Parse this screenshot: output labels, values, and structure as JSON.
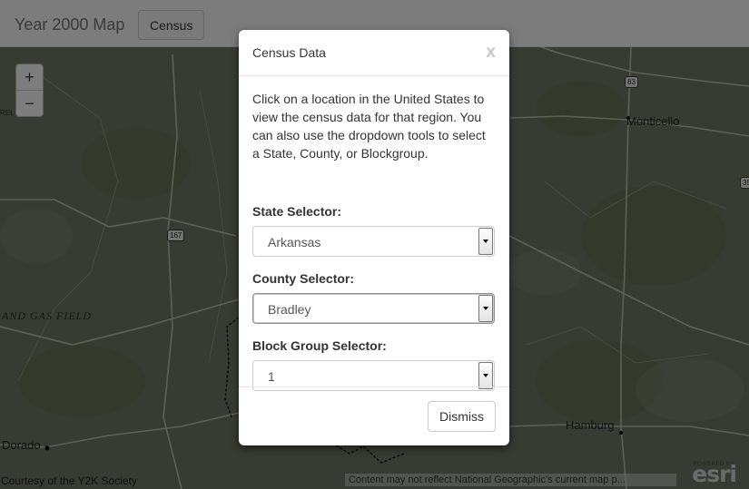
{
  "header": {
    "brand": "Year 2000 Map",
    "census_button": "Census"
  },
  "zoom": {
    "in": "+",
    "out": "−"
  },
  "map": {
    "places": [
      "Monticello",
      "Hamburg",
      "Dorado"
    ],
    "field_label": "AND GAS FIELD",
    "edge_label": "REL",
    "shields": [
      "83",
      "167",
      "35"
    ],
    "attribution": "Courtesy of the Y2K Society",
    "notice": "Content may not reflect National Geographic's current map p...",
    "powered_by": "POWERED BY",
    "esri_logo": "esri"
  },
  "modal": {
    "title": "Census Data",
    "close": "x",
    "intro": "Click on a location in the United States to view the census data for that region. You can also use the dropdown tools to select a State, County, or Blockgroup.",
    "state": {
      "label": "State Selector:",
      "value": "Arkansas"
    },
    "county": {
      "label": "County Selector:",
      "value": "Bradley"
    },
    "blockgroup": {
      "label": "Block Group Selector:",
      "value": "1"
    },
    "dismiss": "Dismiss"
  },
  "colors": {
    "map_base": "#6e7763",
    "road": "#e9e6dc",
    "backdrop": "rgba(0,0,0,0.5)"
  }
}
